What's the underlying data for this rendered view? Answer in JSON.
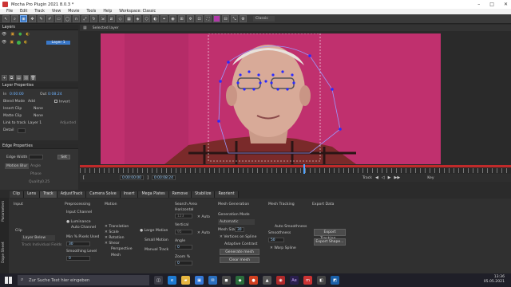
{
  "app": {
    "title": "Mocha Pro Plugin 2021 8.0.3 *"
  },
  "menu": [
    "File",
    "Edit",
    "Track",
    "View",
    "Movie",
    "Tools",
    "Help",
    "Workspace: Classic"
  ],
  "toolbar": {
    "workspace": "Classic",
    "selected_layer_label": "Selected layer"
  },
  "layers_panel": {
    "title": "Layers",
    "layer_name": "Layer 1"
  },
  "layer_properties": {
    "title": "Layer Properties",
    "in_label": "In",
    "in_value": "0:00:00",
    "out_label": "Out",
    "out_value": "0:08:24",
    "blend_mode_label": "Blend Mode",
    "blend_mode_value": "Add",
    "invert_label": "Invert",
    "insert_clip_label": "Insert Clip",
    "insert_clip_value": "None",
    "matte_clip_label": "Matte Clip",
    "matte_clip_value": "None",
    "link_to_track_label": "Link to track",
    "link_to_track_value": "Layer 1",
    "adjusted_label": "Adjusted",
    "detail_label": "Detail"
  },
  "edge_properties": {
    "title": "Edge Properties",
    "edge_width_label": "Edge Width",
    "set_label": "Set",
    "motion_blur_label": "Motion Blur",
    "angle_label": "Angle",
    "phase_label": "Phase",
    "quality_label": "Quality",
    "quality_value": "0.25"
  },
  "timeline": {
    "start": "0:00:00:00",
    "end": "0:00:08:24",
    "track_label": "Track",
    "key_label": "Key"
  },
  "tabs": [
    "Clip",
    "Lens",
    "Track",
    "AdjustTrack",
    "Camera Solve",
    "Insert",
    "Mega Plates",
    "Remove",
    "Stabilize",
    "Reorient"
  ],
  "active_tab": "Track",
  "side_tabs": [
    "Parameters",
    "Dope Sheet"
  ],
  "params": {
    "input_title": "Input",
    "clip_label": "Clip",
    "clip_value": "Layer Below",
    "track_individual": "Track Individual Fields",
    "preprocessing_title": "Preprocessing",
    "input_channel_label": "Input Channel",
    "luminance": "Luminance",
    "auto_channel": "Auto Channel",
    "min_pixels_label": "Min % Pixels Used",
    "min_pixels_value": "30",
    "smoothing_label": "Smoothing Level",
    "smoothing_value": "0",
    "motion_title": "Motion",
    "translation": "Translation",
    "scale": "Scale",
    "rotation": "Rotation",
    "shear": "Shear",
    "perspective": "Perspective",
    "mesh": "Mesh",
    "large_motion": "Large Motion",
    "small_motion": "Small Motion",
    "manual_track": "Manual Track",
    "search_area_title": "Search Area",
    "horizontal_label": "Horizontal",
    "horizontal_value": "123",
    "auto1": "Auto",
    "vertical_label": "Vertical",
    "vertical_value": "95",
    "auto2": "Auto",
    "angle_label": "Angle",
    "angle_value": "0",
    "zoom_label": "Zoom %",
    "zoom_value": "0",
    "mesh_gen_title": "Mesh Generation",
    "gen_mode_label": "Generation Mode",
    "gen_mode_value": "Automatic",
    "mesh_size_label": "Mesh Size",
    "mesh_size_value": "30",
    "vertices_on_spline": "Vertices on Spline",
    "adaptive_contrast": "Adaptive Contrast",
    "generate_mesh": "Generate mesh",
    "clear_mesh": "Clear mesh",
    "mesh_tracking_title": "Mesh Tracking",
    "auto_smoothness": "Auto Smoothness",
    "smoothness_label": "Smoothness",
    "smoothness_value": "50",
    "warp_spline": "Warp Spline",
    "export_title": "Export Data",
    "export_tracking": "Export Tracking...",
    "export_shape": "Export Shape..."
  },
  "taskbar": {
    "search_placeholder": "Zur Suche Text hier eingeben",
    "time": "13:36",
    "date": "05.05.2021"
  }
}
